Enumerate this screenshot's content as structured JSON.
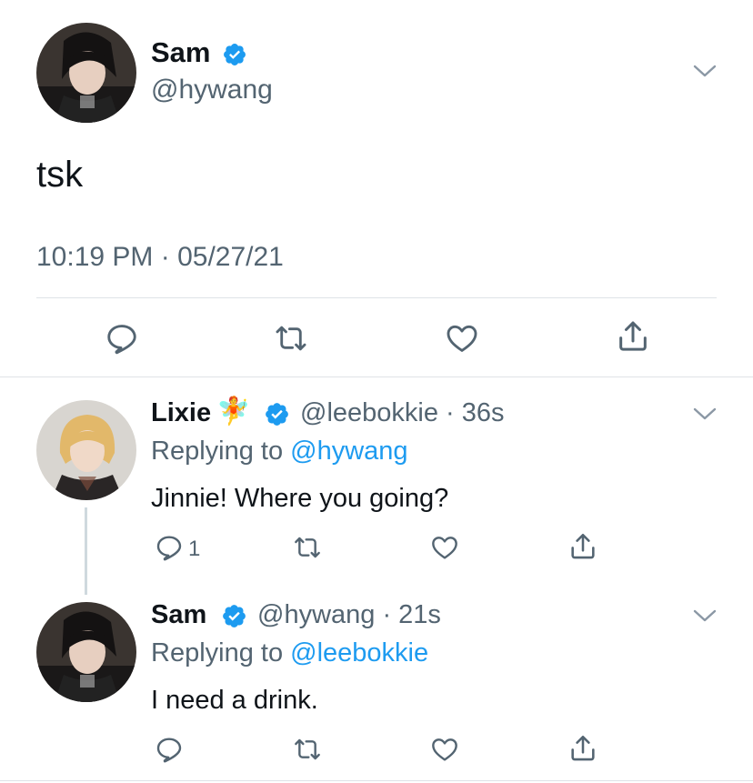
{
  "main_tweet": {
    "name": "Sam",
    "handle": "@hywang",
    "text": "tsk",
    "timestamp": "10:19 PM · 05/27/21"
  },
  "replies": [
    {
      "name": "Lixie",
      "name_emoji": "🧚",
      "handle_time": "@leebokkie · 36s",
      "replying_prefix": "Replying to ",
      "replying_to": "@hywang",
      "text": "Jinnie! Where you going?",
      "reply_count": "1"
    },
    {
      "name": "Sam",
      "handle_time": "@hywang · 21s",
      "replying_prefix": "Replying to ",
      "replying_to": "@leebokkie",
      "text": "I need a drink."
    }
  ],
  "colors": {
    "verified_blue": "#1d9bf0",
    "link_blue": "#1d9bf0",
    "secondary_text": "#536471",
    "divider": "#dfe3e7"
  },
  "icons": [
    "chevron-down-icon",
    "verified-badge-icon",
    "reply-icon",
    "retweet-icon",
    "like-icon",
    "share-icon"
  ]
}
